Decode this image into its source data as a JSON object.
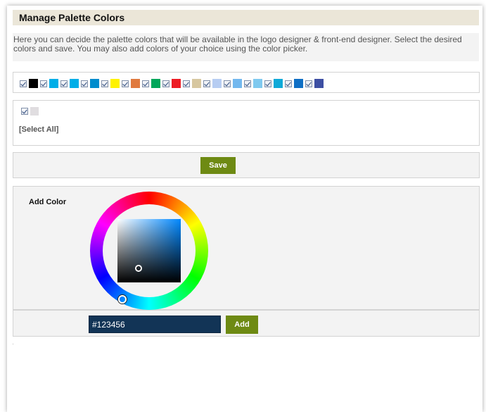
{
  "page": {
    "title": "Manage Palette Colors",
    "intro": "Here you can decide the palette colors that will be available in the logo designer & front-end designer. Select the desired colors and save. You may also add colors of your choice using the color picker."
  },
  "palette": {
    "colors": [
      {
        "hex": "#000000",
        "checked": true
      },
      {
        "hex": "#00aee8",
        "checked": true
      },
      {
        "hex": "#00aee8",
        "checked": true
      },
      {
        "hex": "#008ccd",
        "checked": true
      },
      {
        "hex": "#fff200",
        "checked": true
      },
      {
        "hex": "#e07a3f",
        "checked": true
      },
      {
        "hex": "#00a65a",
        "checked": true
      },
      {
        "hex": "#ed1c24",
        "checked": true
      },
      {
        "hex": "#d7c7a0",
        "checked": true
      },
      {
        "hex": "#b7cdf2",
        "checked": true
      },
      {
        "hex": "#73b8ee",
        "checked": true
      },
      {
        "hex": "#7fc9ef",
        "checked": true
      },
      {
        "hex": "#0fa9d8",
        "checked": true
      },
      {
        "hex": "#0f6fc5",
        "checked": true
      },
      {
        "hex": "#3d4fa3",
        "checked": true
      }
    ],
    "custom_colors": [
      {
        "hex": "#e0dde0",
        "checked": true
      }
    ],
    "select_all_label": "[Select All]"
  },
  "save": {
    "label": "Save",
    "color": "#6e8a13"
  },
  "add_color": {
    "label": "Add Color",
    "value": "#123456",
    "button_label": "Add"
  }
}
